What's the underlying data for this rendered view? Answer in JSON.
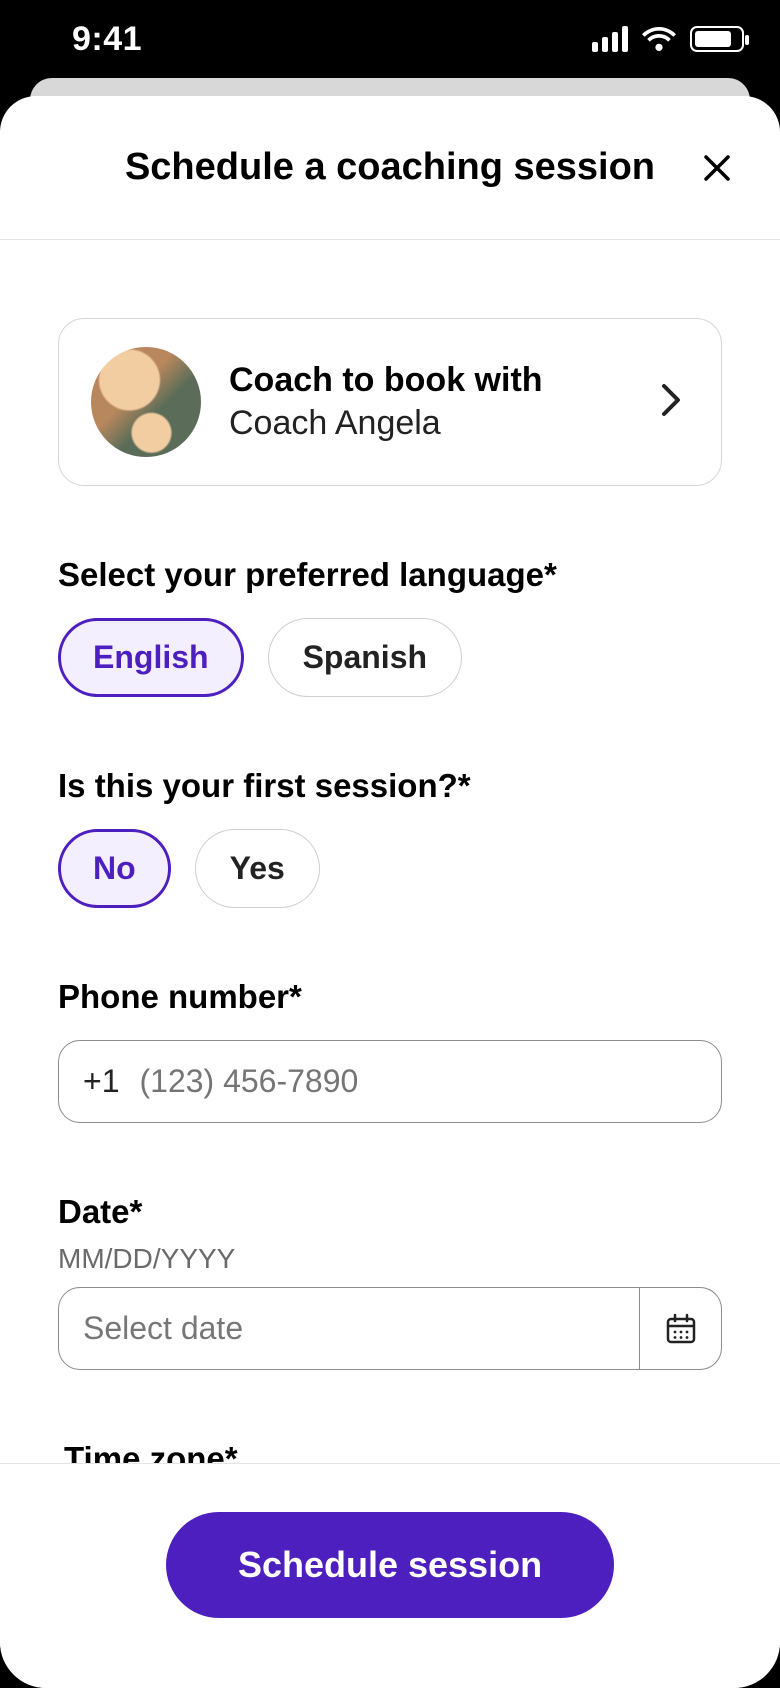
{
  "statusbar": {
    "time": "9:41"
  },
  "sheet": {
    "title": "Schedule a coaching session"
  },
  "coach": {
    "card_title": "Coach to book with",
    "name": "Coach Angela"
  },
  "language": {
    "label": "Select your preferred language*",
    "options": [
      "English",
      "Spanish"
    ],
    "selected": "English"
  },
  "first_session": {
    "label": "Is this your first session?*",
    "options": [
      "No",
      "Yes"
    ],
    "selected": "No"
  },
  "phone": {
    "label": "Phone number*",
    "prefix": "+1",
    "placeholder": "(123) 456-7890"
  },
  "date": {
    "label": "Date*",
    "format_hint": "MM/DD/YYYY",
    "placeholder": "Select date"
  },
  "timezone": {
    "label": "Time zone*"
  },
  "cta": {
    "label": "Schedule session"
  },
  "colors": {
    "accent": "#4e1fbf",
    "accent_bg": "#f4efff"
  }
}
